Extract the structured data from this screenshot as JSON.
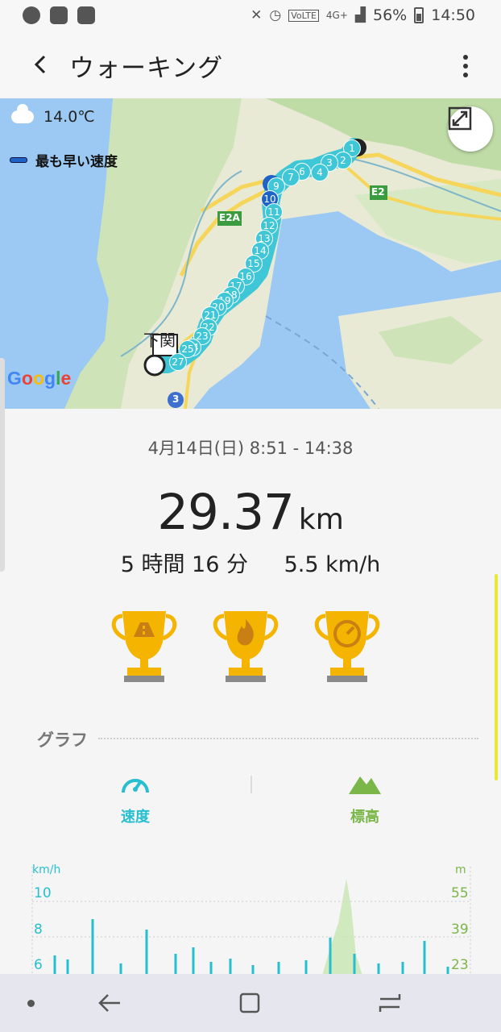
{
  "status_bar": {
    "time": "14:50",
    "battery": "56%",
    "network": "4G+",
    "volte": "VoLTE"
  },
  "app_bar": {
    "title": "ウォーキング"
  },
  "map": {
    "temperature": "14.0℃",
    "legend_label": "最も早い速度",
    "google_logo": "Google",
    "place_label": "下関",
    "road_labels": [
      "E2A",
      "E2",
      "3"
    ],
    "markers": [
      "1",
      "2",
      "3",
      "4",
      "6",
      "7",
      "9",
      "10",
      "11",
      "12",
      "13",
      "14",
      "15",
      "16",
      "17",
      "18",
      "19",
      "20",
      "21",
      "22",
      "23",
      "24",
      "25",
      "27"
    ]
  },
  "summary": {
    "date_range": "4月14日(日) 8:51 - 14:38",
    "distance_value": "29.37",
    "distance_unit": "km",
    "duration": "5 時間 16 分",
    "avg_speed": "5.5 km/h"
  },
  "graph": {
    "title": "グラフ",
    "tabs": [
      {
        "label": "速度",
        "color": "#27bfd0"
      },
      {
        "label": "標高",
        "color": "#7ab648"
      }
    ],
    "left_unit": "km/h",
    "right_unit": "m",
    "left_ticks": [
      "10",
      "8",
      "6"
    ],
    "right_ticks": [
      "55",
      "39",
      "23"
    ]
  },
  "colors": {
    "route": "#3fc7d8",
    "fastest": "#1e63c6",
    "speed": "#27bfd0",
    "elevation": "#7ab648",
    "trophy": "#f4b400"
  }
}
